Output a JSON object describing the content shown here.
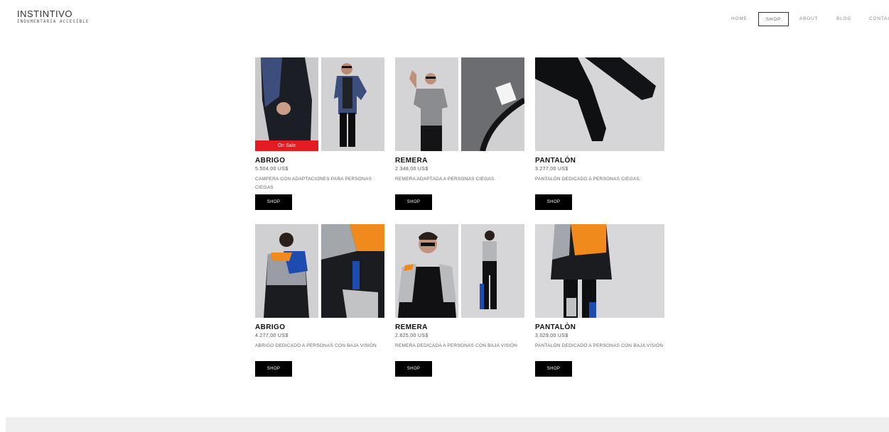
{
  "brand": {
    "title": "INSTINTIVO",
    "subtitle": "INDUMENTARIA ACCESIBLE"
  },
  "nav": [
    {
      "label": "HOME",
      "active": false
    },
    {
      "label": "SHOP",
      "active": true
    },
    {
      "label": "ABOUT",
      "active": false
    },
    {
      "label": "BLOG",
      "active": false
    },
    {
      "label": "CONTACT",
      "active": false
    }
  ],
  "products": [
    {
      "name": "ABRIGO",
      "price": "5.504,00 US$",
      "description": "CAMPERA CON ADAPTACIONES PARA PERSONAS CIEGAS",
      "badge": "On Sale",
      "button": "SHOP"
    },
    {
      "name": "REMERA",
      "price": "2.348,00 US$",
      "description": "REMERA ADAPTADA A PERSONAS CIEGAS.",
      "button": "SHOP"
    },
    {
      "name": "PANTALÒN",
      "price": "3.277,00 US$",
      "description": "PANTALÒN DEDICADO A PERSONAS CIEGAS.",
      "button": "SHOP"
    },
    {
      "name": "ABRIGO",
      "price": "4.277,00 US$",
      "description": "ABRIGO DEDICADO A PERSONAS CON BAJA VISIÓN",
      "button": "SHOP"
    },
    {
      "name": "REMERA",
      "price": "2.625,00 US$",
      "description": "REMERA DEDICADA A PERSONAS CON BAJA VISIÓN",
      "button": "SHOP"
    },
    {
      "name": "PANTALÒN",
      "price": "3.029,00 US$",
      "description": "PANTALÒN DEDICADO A PERSONAS CON BAJA VISIÓN",
      "button": "SHOP"
    }
  ],
  "colors": {
    "sale_badge": "#e31b23",
    "button_bg": "#000000",
    "photo_bg": "#cfcfd1",
    "footer_bg": "#efefef"
  }
}
